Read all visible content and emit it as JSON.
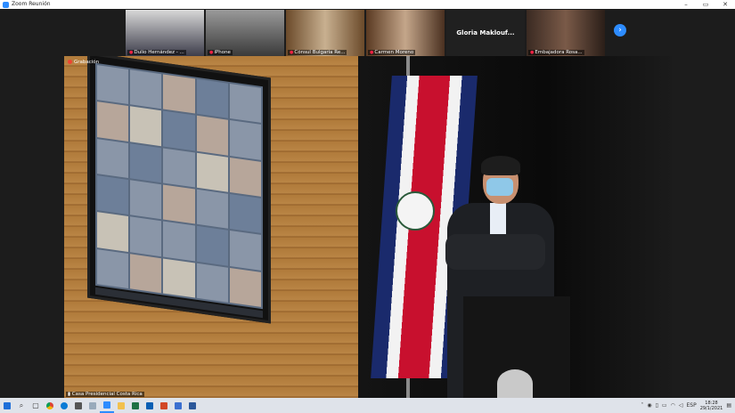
{
  "window": {
    "title": "Zoom Reunión",
    "minimize": "–",
    "maximize": "▭",
    "close": "✕"
  },
  "gallery": {
    "participants": [
      {
        "name": "Dulio Hernández - ..."
      },
      {
        "name": "iPhone"
      },
      {
        "name": "Cónsul Bulgaria Re..."
      },
      {
        "name": "Carmen Moreno"
      },
      {
        "name": "Gloria Maklouf...",
        "no_video": true
      },
      {
        "name": "Embajadora Rosa..."
      }
    ],
    "next_icon": "chevron-right-icon"
  },
  "main_video": {
    "recording_label": "Grabación",
    "speaker_caption": "Casa Presidencial Costa Rica"
  },
  "taskbar": {
    "tray": {
      "lang": "ESP",
      "time": "18:28",
      "date": "29/1/2021"
    }
  },
  "colors": {
    "zoom_blue": "#2d8cff",
    "flag_red": "#c8102e",
    "flag_blue": "#1a2a6c"
  }
}
